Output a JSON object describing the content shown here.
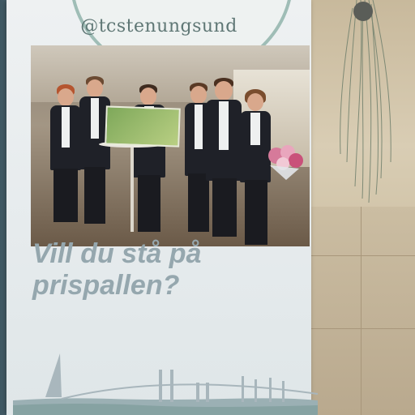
{
  "banner": {
    "handle": "@tcstenungsund",
    "headline_line1": "Vill du stå på",
    "headline_line2": "prispallen?"
  },
  "colors": {
    "banner_bg": "#e8edef",
    "headline": "#95a7ae",
    "badge_ring": "#9fbdb6",
    "handle_text": "#5f7775"
  }
}
